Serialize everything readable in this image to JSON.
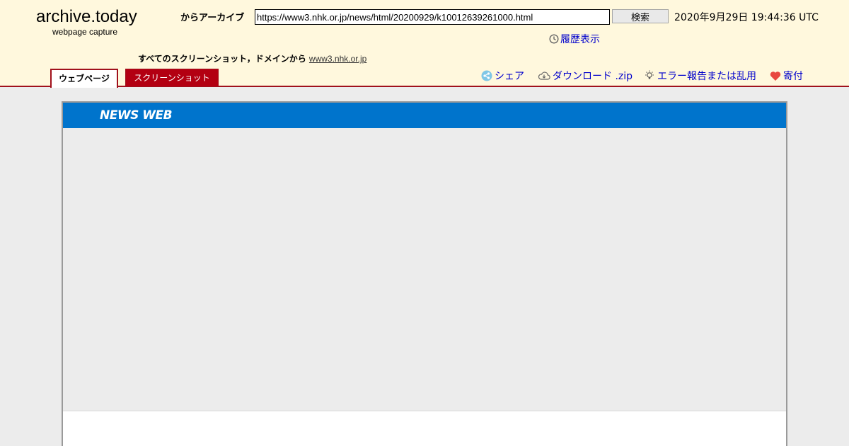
{
  "header": {
    "logo": "archive.today",
    "logo_subtitle": "webpage capture",
    "archive_label": "からアーカイブ",
    "url_value": "https://www3.nhk.or.jp/news/html/20200929/k10012639261000.html",
    "search_button": "検索",
    "capture_date": "2020年9月29日 19:44:36 UTC",
    "history_label": "履歴表示",
    "screenshots_prefix": "すべてのスクリーンショット，ドメインから",
    "screenshots_domain": "www3.nhk.or.jp"
  },
  "tabs": {
    "webpage": "ウェブページ",
    "screenshot": "スクリーンショット"
  },
  "toolbar": {
    "share": "シェア",
    "download": "ダウンロード .zip",
    "report": "エラー報告または乱用",
    "donate": "寄付"
  },
  "page": {
    "nhk_logo": "NEWS WEB"
  },
  "colors": {
    "header_bg": "#fff8dd",
    "accent_red": "#a0101c",
    "link_blue": "#0000cc",
    "nhk_blue": "#0074cc"
  },
  "icons": {
    "history": "clock-icon",
    "share": "share-icon",
    "download": "cloud-download-icon",
    "report": "bulb-icon",
    "donate": "heart-icon"
  }
}
